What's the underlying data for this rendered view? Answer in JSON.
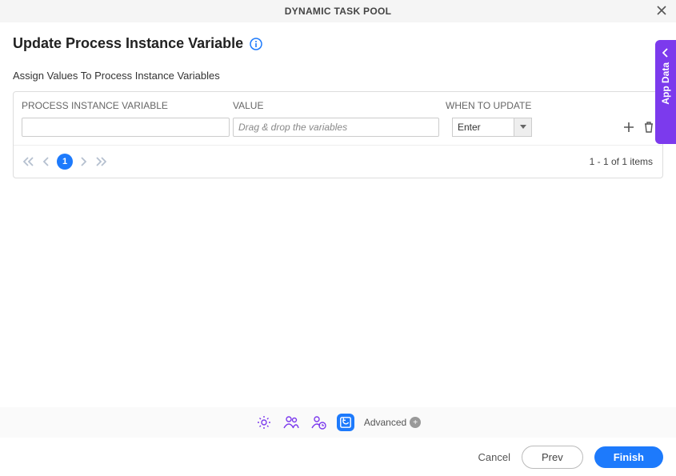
{
  "header": {
    "title": "DYNAMIC TASK POOL"
  },
  "page": {
    "title": "Update Process Instance Variable",
    "subtitle": "Assign Values To Process Instance Variables"
  },
  "table": {
    "headers": {
      "col1": "PROCESS INSTANCE VARIABLE",
      "col2": "VALUE",
      "col3": "WHEN TO UPDATE"
    },
    "row": {
      "value_placeholder": "Drag & drop the variables",
      "select_value": "Enter"
    },
    "pager": {
      "page": "1",
      "status": "1 - 1 of 1 items"
    }
  },
  "sidetab": {
    "label": "App Data"
  },
  "toolbar": {
    "advanced": "Advanced"
  },
  "footer": {
    "cancel": "Cancel",
    "prev": "Prev",
    "finish": "Finish"
  }
}
